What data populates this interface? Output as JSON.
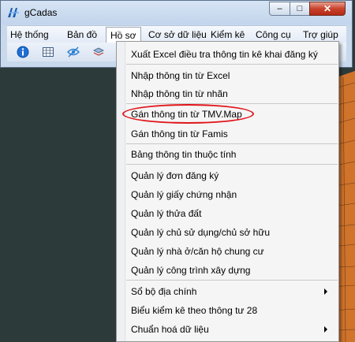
{
  "window": {
    "title": "gCadas",
    "logo_icon": "gcadas-logo-icon",
    "minimize_icon": "minimize-icon",
    "maximize_icon": "maximize-icon",
    "close_icon": "close-icon",
    "minimize_glyph": "–",
    "maximize_glyph": "□",
    "close_glyph": "✕"
  },
  "menubar": {
    "items": [
      {
        "label": "Hệ thống"
      },
      {
        "label": "Bản đồ"
      },
      {
        "label": "Hồ sơ"
      },
      {
        "label": "Cơ sở dữ liệu"
      },
      {
        "label": "Kiểm kê"
      },
      {
        "label": "Công cụ"
      },
      {
        "label": "Trợ giúp"
      }
    ],
    "active": "Hồ sơ"
  },
  "toolbar": {
    "icons": [
      "info-icon",
      "table-grid-icon",
      "eye-hidden-icon",
      "layers-icon"
    ]
  },
  "dropdown": {
    "groups": [
      [
        {
          "label": "Xuất Excel điều tra thông tin kê khai đăng ký"
        }
      ],
      [
        {
          "label": "Nhập thông tin từ Excel"
        },
        {
          "label": "Nhập thông tin từ nhãn"
        }
      ],
      [
        {
          "label": "Gán thông tin từ TMV.Map",
          "highlighted": true
        },
        {
          "label": "Gán thông tin từ Famis"
        }
      ],
      [
        {
          "label": "Bảng thông tin thuộc tính"
        }
      ],
      [
        {
          "label": "Quản lý đơn đăng ký"
        },
        {
          "label": "Quản lý giấy chứng nhận"
        },
        {
          "label": "Quản lý thửa đất"
        },
        {
          "label": "Quản lý chủ sử dụng/chủ sở hữu"
        },
        {
          "label": "Quản lý nhà ở/căn hộ chung cư"
        },
        {
          "label": "Quản lý công trình xây dựng"
        }
      ],
      [
        {
          "label": "Sổ bộ địa chính",
          "submenu": true
        },
        {
          "label": "Biểu kiểm kê theo thông tư 28"
        },
        {
          "label": "Chuẩn hoá dữ liệu",
          "submenu": true
        }
      ]
    ]
  },
  "colors": {
    "highlight_ellipse": "#e0151b",
    "close_button": "#c8432c",
    "map_background": "#2e3b3b",
    "map_parcels": "#f0822a"
  }
}
